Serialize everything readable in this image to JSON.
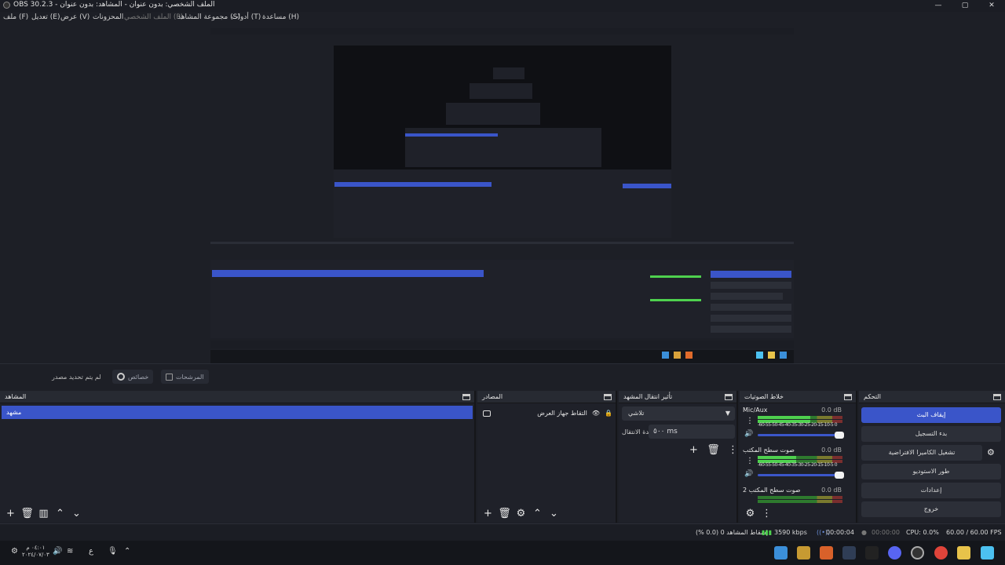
{
  "window": {
    "title": "OBS 30.2.3 - الملف الشخصي: بدون عنوان - المشاهد: بدون عنوان",
    "controls": {
      "minimize": "—",
      "maximize": "▢",
      "close": "✕"
    }
  },
  "menu": [
    {
      "label": "ملف (F)"
    },
    {
      "label": "تعديل (E)"
    },
    {
      "label": "عرض (V)"
    },
    {
      "label": "المحزونات"
    },
    {
      "label": "الملف الشخصي (P)"
    },
    {
      "label": "مجموعة المشاهد (S)"
    },
    {
      "label": "أدوات (T)"
    },
    {
      "label": "مساعدة (H)"
    }
  ],
  "source_toolbar": {
    "no_source": "لم يتم تحديد مصدر",
    "properties": "خصائص",
    "filters": "المرشحات"
  },
  "docks": {
    "scenes": {
      "title": "المشاهد",
      "items": [
        "مشهد"
      ]
    },
    "sources": {
      "title": "المصادر",
      "items": [
        {
          "name": "التقاط جهاز العرض"
        }
      ]
    },
    "transitions": {
      "title": "تأثير انتقال المشهد",
      "selected": "تلاشي",
      "duration_label": "مدة الانتقال",
      "duration_value": "٥٠٠ ms"
    },
    "mixer": {
      "title": "خلاط الصوتيات",
      "channels": [
        {
          "name": "Mic/Aux",
          "db": "0.0 dB",
          "level": 0.62,
          "ticks": "-60-55-50-45-40-35-30-25-20-15-10-5 0"
        },
        {
          "name": "صوت سطح المكتب",
          "db": "0.0 dB",
          "level": 0.45,
          "ticks": "-60-55-50-45-40-35-30-25-20-15-10-5 0"
        },
        {
          "name": "صوت سطح المكتب 2",
          "db": "0.0 dB",
          "level": 0.0
        }
      ]
    },
    "controls": {
      "title": "التحكم",
      "buttons": [
        "إيقاف البث",
        "بدء التسجيل",
        "تشغيل الكاميرا الافتراضية",
        "طور الاستوديو",
        "إعدادات",
        "خروج"
      ]
    }
  },
  "status": {
    "dropped": "إسقاط المشاهد 0 (0.0 %)",
    "bitrate": "3590 kbps",
    "stream_time": "00:00:04",
    "rec_time": "00:00:00",
    "cpu": "CPU: 0.0%",
    "fps": "60.00 / 60.00 FPS"
  },
  "taskbar": {
    "time": "٠٤:٠١ م",
    "date": "٢٠٢٤/٠٧/٠٣",
    "lang": "ع"
  },
  "colors": {
    "accent": "#3a55c9",
    "bg": "#1d1f26",
    "panel": "#1f2129"
  }
}
